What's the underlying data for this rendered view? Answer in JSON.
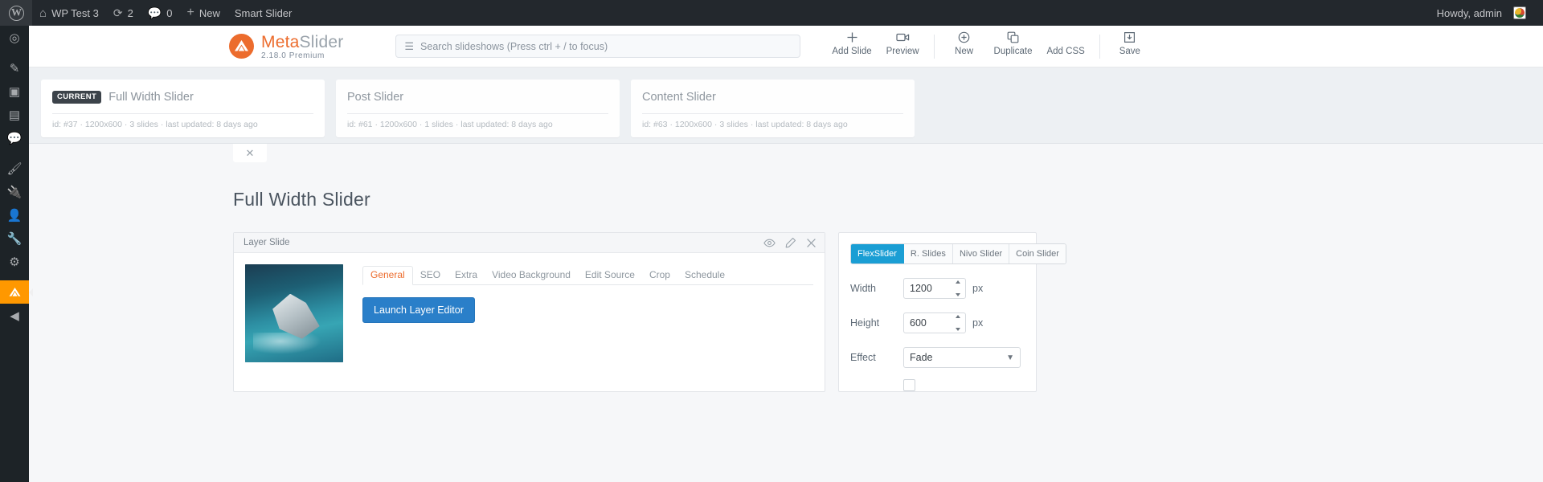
{
  "adminbar": {
    "logo_icon": "wordpress-logo-icon",
    "site_name": "WP Test 3",
    "home_icon": "home-icon",
    "updates_icon": "updates-icon",
    "updates_count": "2",
    "comments_icon": "comments-icon",
    "comments_count": "0",
    "new_icon": "plus-icon",
    "new_label": "New",
    "plugin_label": "Smart Slider",
    "howdy": "Howdy, admin",
    "avatar_icon": "user-avatar"
  },
  "sidebar": {
    "items": [
      {
        "icon": "dashboard-icon",
        "glyph": "⌂"
      },
      {
        "icon": "posts-icon",
        "glyph": "✒"
      },
      {
        "icon": "media-icon",
        "glyph": "▣"
      },
      {
        "icon": "pages-icon",
        "glyph": "❐"
      },
      {
        "icon": "comments-icon",
        "glyph": "▭"
      },
      {
        "icon": "appearance-icon",
        "glyph": "⚒"
      },
      {
        "icon": "plugins-icon",
        "glyph": "✇"
      },
      {
        "icon": "users-icon",
        "glyph": "☺"
      },
      {
        "icon": "tools-icon",
        "glyph": "⚒"
      },
      {
        "icon": "settings-icon",
        "glyph": "⚙"
      },
      {
        "icon": "metaslider-icon",
        "glyph": "▲"
      },
      {
        "icon": "collapse-icon",
        "glyph": "◀"
      }
    ]
  },
  "header": {
    "brand": {
      "mark_icon": "metaslider-logo-icon",
      "name_part1": "Meta",
      "name_part2": "Slider",
      "version": "2.18.0 Premium"
    },
    "search": {
      "icon": "menu-bars-icon",
      "placeholder": "Search slideshows (Press ctrl + / to focus)",
      "value": ""
    },
    "actions": [
      {
        "label": "Add Slide",
        "icon": "plus-icon"
      },
      {
        "label": "Preview",
        "icon": "camera-icon"
      },
      {
        "label": "New",
        "icon": "circle-plus-icon"
      },
      {
        "label": "Duplicate",
        "icon": "duplicate-icon"
      },
      {
        "label": "Add CSS",
        "icon": "css-icon"
      },
      {
        "label": "Save",
        "icon": "save-icon"
      }
    ]
  },
  "slideshows": [
    {
      "badge": "CURRENT",
      "title": "Full Width Slider",
      "meta": "id: #37 · 1200x600 · 3 slides · last updated: 8 days ago",
      "active": true
    },
    {
      "badge": "",
      "title": "Post Slider",
      "meta": "id: #61 · 1200x600 · 1 slides · last updated: 8 days ago",
      "active": false
    },
    {
      "badge": "",
      "title": "Content Slider",
      "meta": "id: #63 · 1200x600 · 3 slides · last updated: 8 days ago",
      "active": false
    }
  ],
  "stub": {
    "close_icon": "close-icon"
  },
  "page": {
    "title": "Full Width Slider"
  },
  "slide": {
    "header_name": "Layer Slide",
    "icons": [
      {
        "name": "eye-icon",
        "glyph": "◉"
      },
      {
        "name": "pencil-icon",
        "glyph": "✎"
      },
      {
        "name": "close-icon",
        "glyph": "✕"
      }
    ],
    "thumb_alt": "aerial boat photo thumbnail",
    "tabs": [
      {
        "label": "General",
        "active": true
      },
      {
        "label": "SEO",
        "active": false
      },
      {
        "label": "Extra",
        "active": false
      },
      {
        "label": "Video Background",
        "active": false
      },
      {
        "label": "Edit Source",
        "active": false
      },
      {
        "label": "Crop",
        "active": false
      },
      {
        "label": "Schedule",
        "active": false
      }
    ],
    "launch_label": "Launch Layer Editor"
  },
  "settings": {
    "slider_types": [
      {
        "label": "FlexSlider",
        "active": true
      },
      {
        "label": "R. Slides",
        "active": false
      },
      {
        "label": "Nivo Slider",
        "active": false
      },
      {
        "label": "Coin Slider",
        "active": false
      }
    ],
    "width": {
      "label": "Width",
      "value": "1200",
      "unit": "px"
    },
    "height": {
      "label": "Height",
      "value": "600",
      "unit": "px"
    },
    "effect": {
      "label": "Effect",
      "value": "Fade",
      "chevron": "chevron-down-icon"
    }
  },
  "colors": {
    "brand_orange": "#ec6c2d",
    "accent_blue": "#2a7fc9",
    "seg_active": "#1a9ed4",
    "admin_dark": "#23282d"
  }
}
